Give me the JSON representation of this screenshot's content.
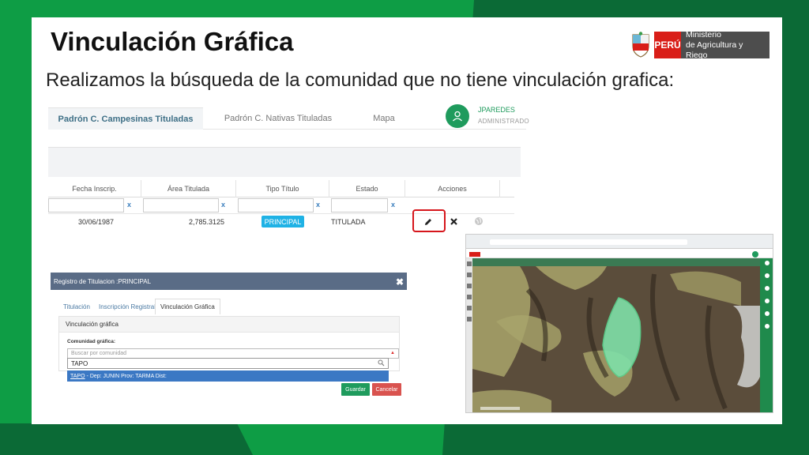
{
  "slide": {
    "title": "Vinculación Gráfica",
    "subtitle": "Realizamos la búsqueda de la comunidad que no tiene vinculación grafica:"
  },
  "logo": {
    "country": "PERÚ",
    "ministry_line1": "Ministerio",
    "ministry_line2": "de Agricultura y Riego"
  },
  "app": {
    "tabs": [
      {
        "label": "Padrón C. Campesinas Tituladas",
        "active": true
      },
      {
        "label": "Padrón C. Nativas Tituladas",
        "active": false
      },
      {
        "label": "Mapa",
        "active": false
      }
    ],
    "user": {
      "name": "JPAREDES",
      "role": "ADMINISTRADO"
    },
    "table": {
      "headers": [
        "Fecha Inscrip.",
        "Área Titulada",
        "Tipo Título",
        "Estado",
        "Acciones"
      ],
      "filter_clear": "x",
      "row": {
        "fecha": "30/06/1987",
        "area": "2,785.3125",
        "tipo": "PRINCIPAL",
        "estado": "TITULADA"
      }
    }
  },
  "dialog": {
    "title": "Registro de Titulacion :PRINCIPAL",
    "close": "✖",
    "tabs": [
      "Titulación",
      "Inscripción Registral",
      "Vinculación Gráfica"
    ],
    "panel_title": "Vinculación gráfica",
    "field_label": "Comunidad gráfica:",
    "select_placeholder": "Buscar por comunidad",
    "search_value": "TAPO",
    "result_name": "TAPO",
    "result_detail": "- Dep: JUNIN Prov: TARMA Dist:",
    "save_label": "Guardar",
    "cancel_label": "Cancelar"
  },
  "colors": {
    "brand_green": "#0e9d45",
    "dark_green": "#0b6a36",
    "highlight_red": "#d6161c",
    "badge_blue": "#1fb2e5",
    "save_green": "#1f9b5d",
    "cancel_red": "#d9534f"
  }
}
